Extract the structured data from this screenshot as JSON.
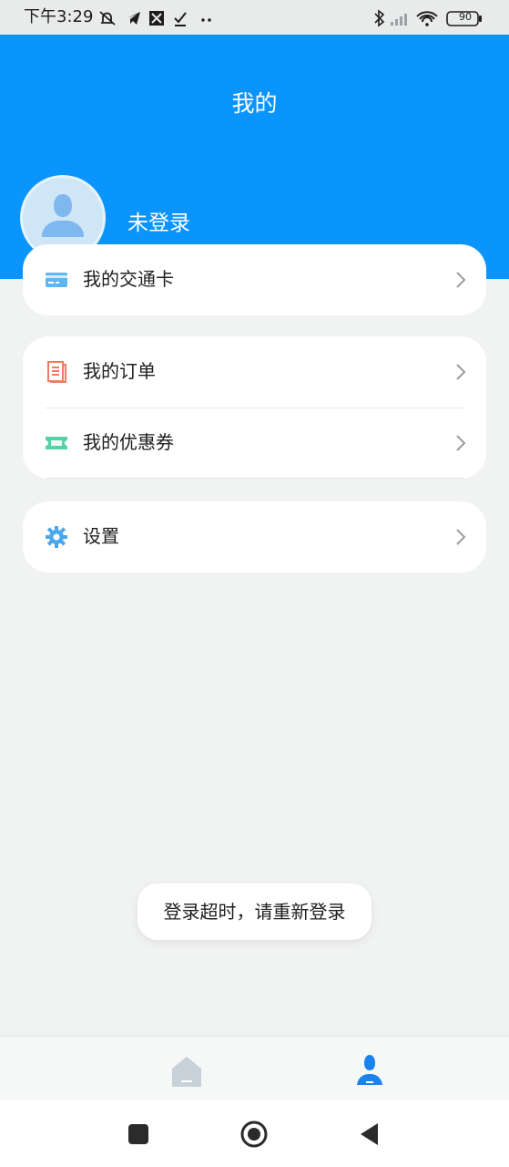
{
  "status_bar": {
    "time": "下午3:29",
    "battery": "90"
  },
  "header": {
    "title": "我的",
    "login_status": "未登录"
  },
  "menu": {
    "card": {
      "label": "我的交通卡"
    },
    "orders": {
      "label": "我的订单"
    },
    "coupons": {
      "label": "我的优惠券"
    },
    "settings": {
      "label": "设置"
    }
  },
  "toast": {
    "message": "登录超时，请重新登录"
  },
  "colors": {
    "accent": "#0a94fe",
    "background": "#f1f2f2"
  }
}
